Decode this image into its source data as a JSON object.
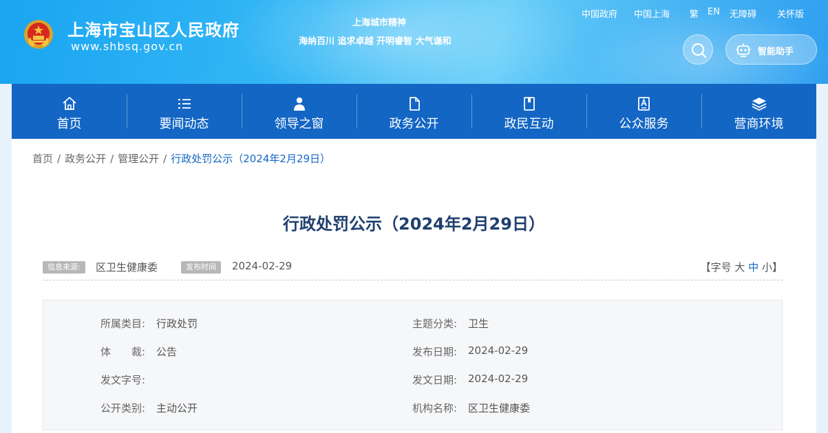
{
  "header": {
    "site_title": "上海市宝山区人民政府",
    "site_url": "www.shbsq.gov.cn",
    "spirit_title": "上海城市精神",
    "spirit_text": "海纳百川 追求卓越 开明睿智 大气谦和",
    "top_links": [
      "中国政府",
      "中国上海",
      "繁",
      "EN",
      "无障碍",
      "关怀版"
    ],
    "ai_assistant_label": "智能助手",
    "emblem_icon": "national-emblem-icon",
    "search_icon": "search-icon",
    "ai_icon": "robot-icon"
  },
  "nav": {
    "items": [
      {
        "label": "首页",
        "icon": "home-icon"
      },
      {
        "label": "要闻动态",
        "icon": "list-icon"
      },
      {
        "label": "领导之窗",
        "icon": "person-icon"
      },
      {
        "label": "政务公开",
        "icon": "document-icon"
      },
      {
        "label": "政民互动",
        "icon": "bookmark-icon"
      },
      {
        "label": "公众服务",
        "icon": "service-icon"
      },
      {
        "label": "营商环境",
        "icon": "layers-icon"
      }
    ]
  },
  "breadcrumb": {
    "items": [
      "首页",
      "政务公开",
      "管理公开",
      "行政处罚公示（2024年2月29日）"
    ]
  },
  "article": {
    "title": "行政处罚公示（2024年2月29日）",
    "source_tag": "信息来源:",
    "source_value": "区卫生健康委",
    "date_tag": "发布时间",
    "date_value": "2024-02-29",
    "font_size_prefix": "【字号",
    "font_large": "大",
    "font_medium": "中",
    "font_small": "小",
    "font_size_suffix": "】"
  },
  "info": {
    "category_label": "所属类目:",
    "category_value": "行政处罚",
    "theme_label": "主题分类:",
    "theme_value": "卫生",
    "genre_label": "体　　裁:",
    "genre_value": "公告",
    "publish_date_label": "发布日期:",
    "publish_date_value": "2024-02-29",
    "doc_number_label": "发文字号:",
    "doc_number_value": "",
    "doc_date_label": "发文日期:",
    "doc_date_value": "2024-02-29",
    "open_type_label": "公开类别:",
    "open_type_value": "主动公开",
    "org_label": "机构名称:",
    "org_value": "区卫生健康委"
  },
  "colors": {
    "nav_bg": "#1366c4",
    "title_color": "#1f3f6e",
    "accent": "#1366c4"
  }
}
